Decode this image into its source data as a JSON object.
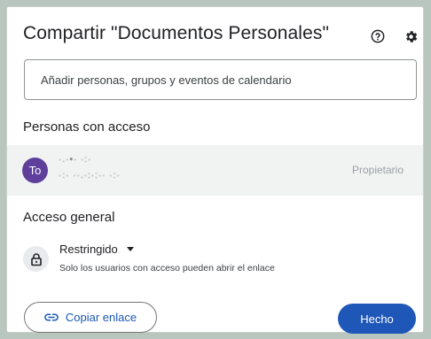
{
  "dialog": {
    "title": "Compartir \"Documentos Personales\"",
    "help_icon": "help-circle-icon",
    "settings_icon": "gear-icon"
  },
  "search": {
    "placeholder": "Añadir personas, grupos y eventos de calendario"
  },
  "people_section": {
    "heading": "Personas con acceso",
    "people": [
      {
        "avatar_initials": "To",
        "avatar_color": "#5e3f9b",
        "name": "·.·•· ·:·",
        "email": "·:· ··.·:·:·· ·:·",
        "role": "Propietario"
      }
    ]
  },
  "general_access": {
    "heading": "Acceso general",
    "lock_icon": "lock-icon",
    "selected_option": "Restringido",
    "description": "Solo los usuarios con acceso pueden abrir el enlace"
  },
  "actions": {
    "copy_link_label": "Copiar enlace",
    "copy_link_icon": "link-icon",
    "done_label": "Hecho"
  },
  "colors": {
    "accent": "#1f57b8",
    "link_text": "#1a57b5",
    "row_highlight": "#f1f3f2"
  }
}
